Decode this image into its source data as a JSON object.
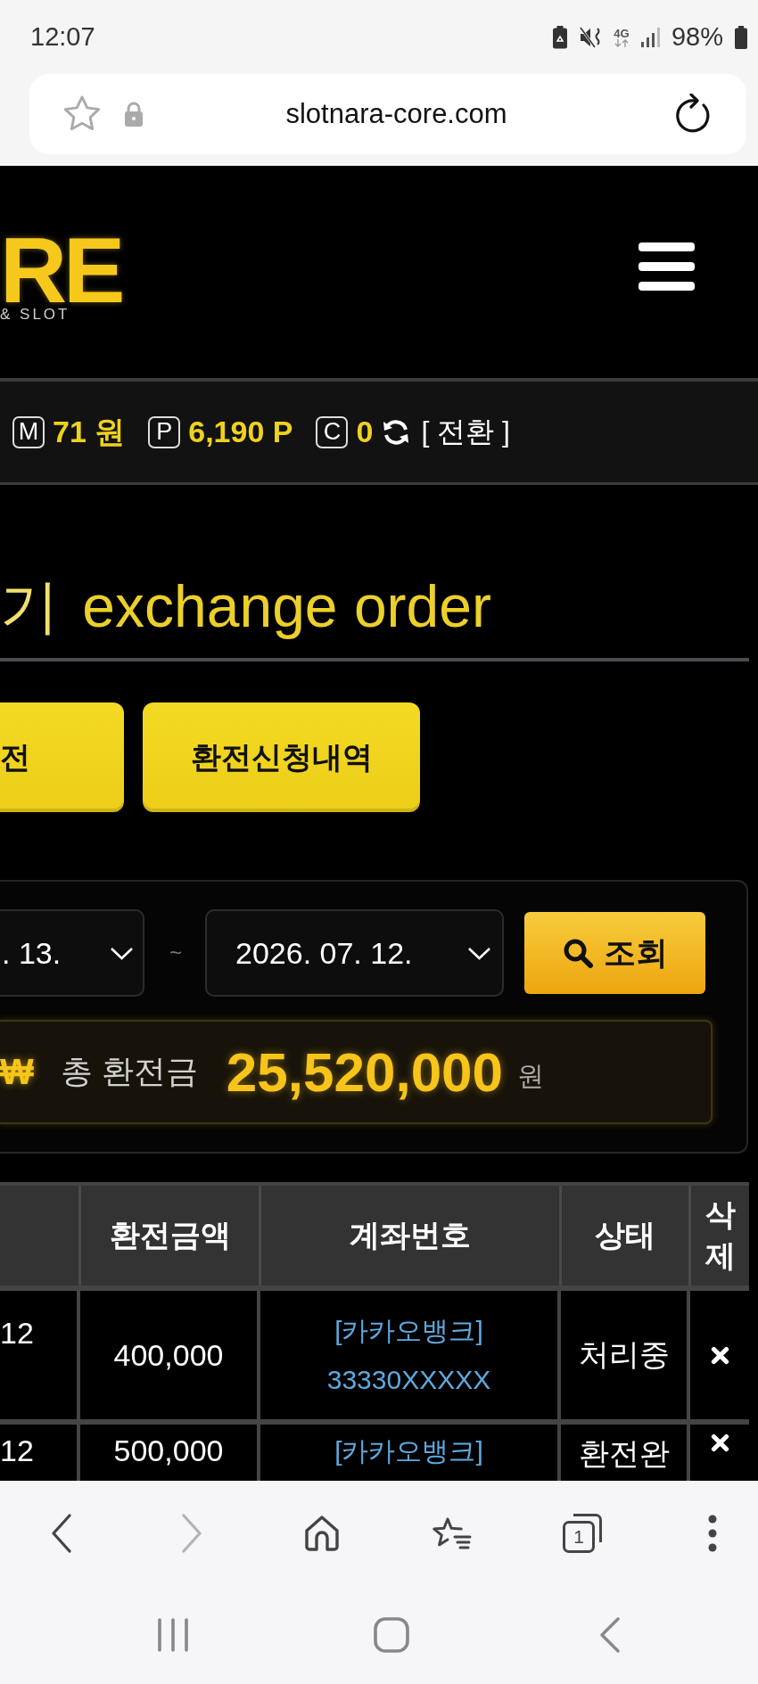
{
  "status_bar": {
    "time": "12:07",
    "network_type": "4G",
    "battery": "98%"
  },
  "address_bar": {
    "url": "slotnara-core.com"
  },
  "header": {
    "logo": "RE",
    "logo_tagline": "& SLOT"
  },
  "balance_bar": {
    "items": [
      {
        "badge": "M",
        "value": "71 원"
      },
      {
        "badge": "P",
        "value": "6,190 P"
      },
      {
        "badge": "C",
        "value": "0"
      }
    ],
    "convert_label": "[ 전환 ]"
  },
  "page_title": {
    "korean": "기",
    "english": "exchange order"
  },
  "buttons": [
    "전",
    "환전신청내역"
  ],
  "filter": {
    "date_from": ". 13.",
    "separator": "~",
    "date_to": "2026. 07. 12.",
    "search_button": "조회"
  },
  "total": {
    "currency_symbol": "₩",
    "label": "총 환전금",
    "amount": "25,520,000",
    "unit": "원"
  },
  "table": {
    "columns": [
      "환전금액",
      "계좌번호",
      "상태",
      "삭제"
    ],
    "rows": [
      {
        "column_1": "12",
        "amount": "400,000",
        "bank": "[카카오뱅크]",
        "account": "33330XXXXX",
        "status": "처리중"
      },
      {
        "column_1": "12",
        "amount": "500,000",
        "bank": "[카카오뱅크]",
        "status": "환전완"
      }
    ]
  },
  "browser_toolbar": {
    "forward_disabled": true,
    "tab_count": "1"
  }
}
